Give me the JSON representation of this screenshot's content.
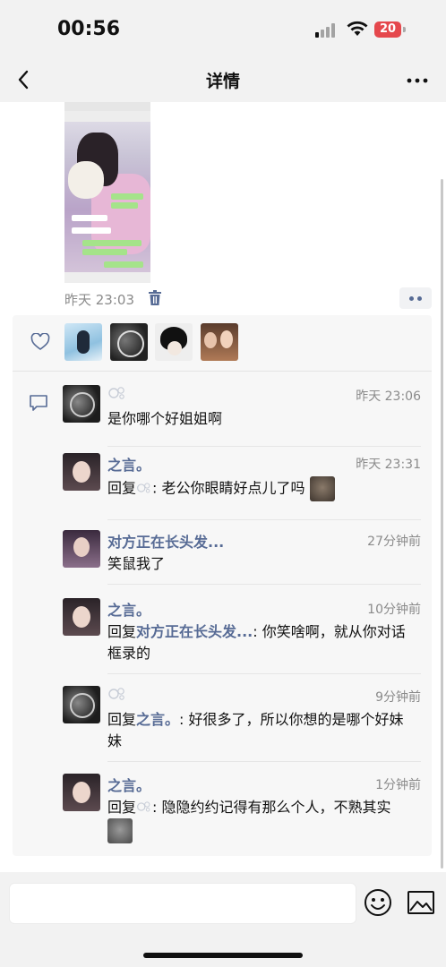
{
  "status": {
    "time": "00:56",
    "battery": "20"
  },
  "nav": {
    "title": "详情"
  },
  "post": {
    "meta": "昨天 23:03"
  },
  "comments": [
    {
      "name": "",
      "time": "昨天 23:06",
      "text": "是你哪个好姐姐啊"
    },
    {
      "name": "之言。",
      "time": "昨天 23:31",
      "reply_prefix": "回复",
      "reply_to": "",
      "text": ": 老公你眼睛好点儿了吗"
    },
    {
      "name": "对方正在长头发...",
      "time": "27分钟前",
      "text": "笑鼠我了"
    },
    {
      "name": "之言。",
      "time": "10分钟前",
      "reply_prefix": "回复",
      "reply_to": "对方正在长头发...",
      "text": ": 你笑啥啊，就从你对话框录的"
    },
    {
      "name": "",
      "time": "9分钟前",
      "reply_prefix": "回复",
      "reply_to": "之言。",
      "text": ": 好很多了，所以你想的是哪个好妹妹"
    },
    {
      "name": "之言。",
      "time": "1分钟前",
      "reply_prefix": "回复",
      "reply_to": "",
      "text": ": 隐隐约约记得有那么个人，不熟其实"
    }
  ],
  "icons": {
    "back": "back-chevron-icon",
    "more": "more-dots-icon",
    "trash": "trash-icon",
    "heart": "heart-outline-icon",
    "comment": "comment-bubble-icon",
    "emoji": "emoji-icon",
    "image": "image-icon"
  },
  "colors": {
    "link": "#576b95",
    "battery": "#e5484d"
  }
}
